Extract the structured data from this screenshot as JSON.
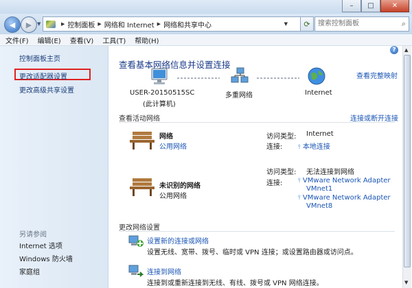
{
  "window": {
    "minimize": "–",
    "maximize": "□",
    "close": "✕"
  },
  "address": {
    "crumbs": [
      "控制面板",
      "网络和 Internet",
      "网络和共享中心"
    ],
    "search_placeholder": "搜索控制面板"
  },
  "menu": [
    "文件(F)",
    "编辑(E)",
    "查看(V)",
    "工具(T)",
    "帮助(H)"
  ],
  "sidebar": {
    "home": "控制面板主页",
    "adapter": "更改适配器设置",
    "sharing": "更改高级共享设置",
    "see_also": "另请参阅",
    "see_also_items": [
      "Internet 选项",
      "Windows 防火墙",
      "家庭组"
    ]
  },
  "main": {
    "title": "查看基本网络信息并设置连接",
    "full_map": "查看完整映射",
    "map": {
      "computer": "USER-20150515SC",
      "computer_sub": "(此计算机)",
      "network": "多重网络",
      "internet": "Internet"
    },
    "active_title": "查看活动网络",
    "connect_link": "连接或断开连接",
    "networks": [
      {
        "name": "网络",
        "type": "公用网络",
        "access_label": "访问类型:",
        "access_value": "Internet",
        "conn_label": "连接:",
        "conn_values": [
          "本地连接"
        ]
      },
      {
        "name": "未识别的网络",
        "type": "公用网络",
        "access_label": "访问类型:",
        "access_value": "无法连接到网络",
        "conn_label": "连接:",
        "conn_values": [
          "VMware Network Adapter",
          "VMnet1",
          "VMware Network Adapter",
          "VMnet8"
        ]
      }
    ],
    "change_title": "更改网络设置",
    "tasks": [
      {
        "title": "设置新的连接或网络",
        "desc": "设置无线、宽带、拨号、临时或 VPN 连接；或设置路由器或访问点。"
      },
      {
        "title": "连接到网络",
        "desc": "连接到或重新连接到无线、有线、拨号或 VPN 网络连接。"
      }
    ]
  }
}
